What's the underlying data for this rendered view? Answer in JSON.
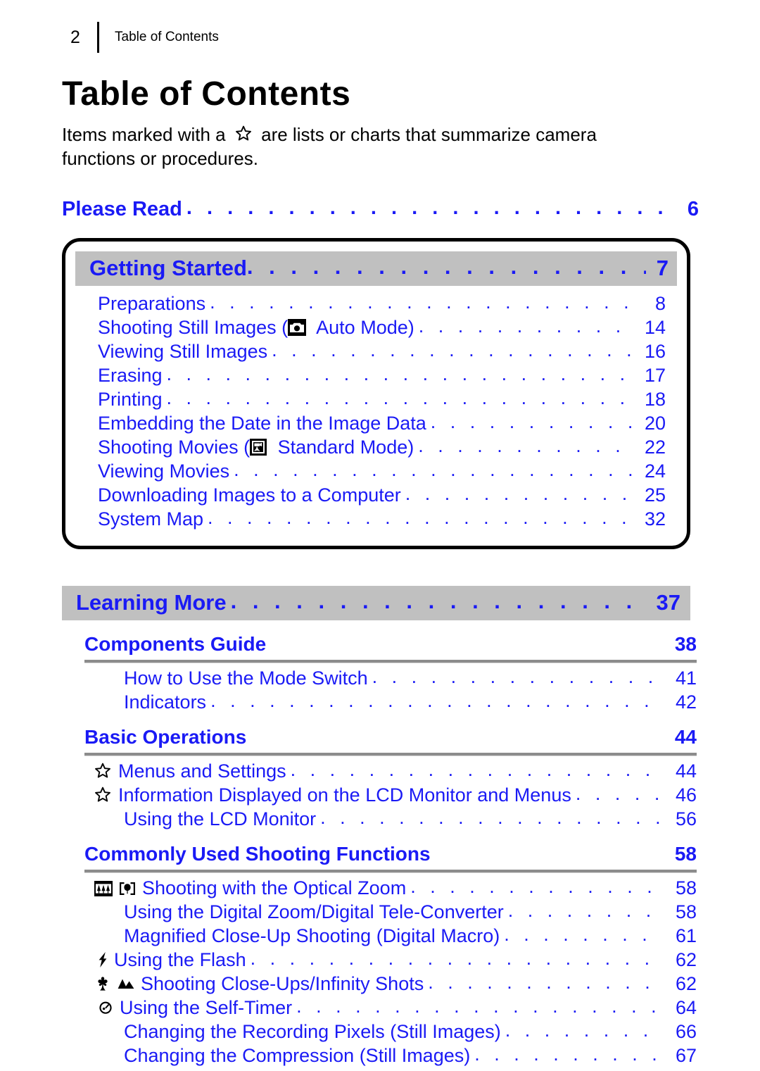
{
  "header": {
    "page_number": "2",
    "title": "Table of Contents"
  },
  "title": "Table of Contents",
  "intro": {
    "before_star": "Items marked with a",
    "after_star": "are lists or charts that summarize camera functions or procedures.",
    "star_icon": "star-outline-icon"
  },
  "colors": {
    "link_blue": "#1a1af5",
    "band_gray": "#c0c0c0",
    "rule_gray": "#8c8c8c",
    "text_black": "#000000"
  },
  "please_read": {
    "label": "Please Read",
    "page": "6"
  },
  "getting_started": {
    "band": {
      "label": "Getting Started",
      "page": "7"
    },
    "items": [
      {
        "label": "Preparations",
        "page": "8"
      },
      {
        "label_pre": "Shooting Still Images (",
        "icon": "camera-auto-mode-icon",
        "label_post": " Auto Mode)",
        "page": "14"
      },
      {
        "label": "Viewing Still Images",
        "page": "16"
      },
      {
        "label": "Erasing",
        "page": "17"
      },
      {
        "label": "Printing",
        "page": "18"
      },
      {
        "label": "Embedding the Date in the Image Data",
        "page": "20"
      },
      {
        "label_pre": "Shooting Movies (",
        "icon": "movie-standard-mode-icon",
        "label_post": " Standard Mode)",
        "page": "22"
      },
      {
        "label": "Viewing Movies",
        "page": "24"
      },
      {
        "label": "Downloading Images to a Computer",
        "page": "25"
      },
      {
        "label": "System Map",
        "page": "32"
      }
    ]
  },
  "learning_more": {
    "band": {
      "label": "Learning More",
      "page": "37"
    },
    "sections": [
      {
        "heading": "Components Guide",
        "heading_page": "38",
        "items": [
          {
            "label": "How to Use the Mode Switch",
            "page": "41"
          },
          {
            "label": "Indicators",
            "page": "42"
          }
        ]
      },
      {
        "heading": "Basic Operations",
        "heading_page": "44",
        "items": [
          {
            "star": "star-outline-icon",
            "label": "Menus and Settings",
            "page": "44"
          },
          {
            "star": "star-outline-icon",
            "label": "Information Displayed on the LCD Monitor and Menus",
            "page": "46"
          },
          {
            "label": "Using the LCD Monitor",
            "page": "56"
          }
        ]
      },
      {
        "heading": "Commonly Used Shooting Functions",
        "heading_page": "58",
        "items": [
          {
            "icons": [
              "zoom-wide-icon",
              "zoom-tele-icon"
            ],
            "label": "Shooting with the Optical Zoom",
            "page": "58"
          },
          {
            "label": "Using the Digital Zoom/Digital Tele-Converter",
            "page": "58"
          },
          {
            "label": "Magnified Close-Up Shooting (Digital Macro)",
            "page": "61"
          },
          {
            "icons": [
              "flash-icon"
            ],
            "label": "Using the Flash",
            "page": "62"
          },
          {
            "icons": [
              "macro-flower-icon",
              "infinity-mountain-icon"
            ],
            "label": "Shooting Close-Ups/Infinity Shots",
            "page": "62"
          },
          {
            "icons": [
              "self-timer-icon"
            ],
            "label": "Using the Self-Timer",
            "page": "64"
          },
          {
            "label": "Changing the Recording Pixels (Still Images)",
            "page": "66"
          },
          {
            "label": "Changing the Compression (Still Images)",
            "page": "67"
          }
        ]
      }
    ]
  },
  "leader_dots": ". . . . . . . . . . . . . . . . . . . . . . . . . . . . . . . . . . . . . . . . . . . . . . . . . . . . . . . . . . . . . . . . . . . . . . . . . . . . . . . . . . . . . . . . ."
}
